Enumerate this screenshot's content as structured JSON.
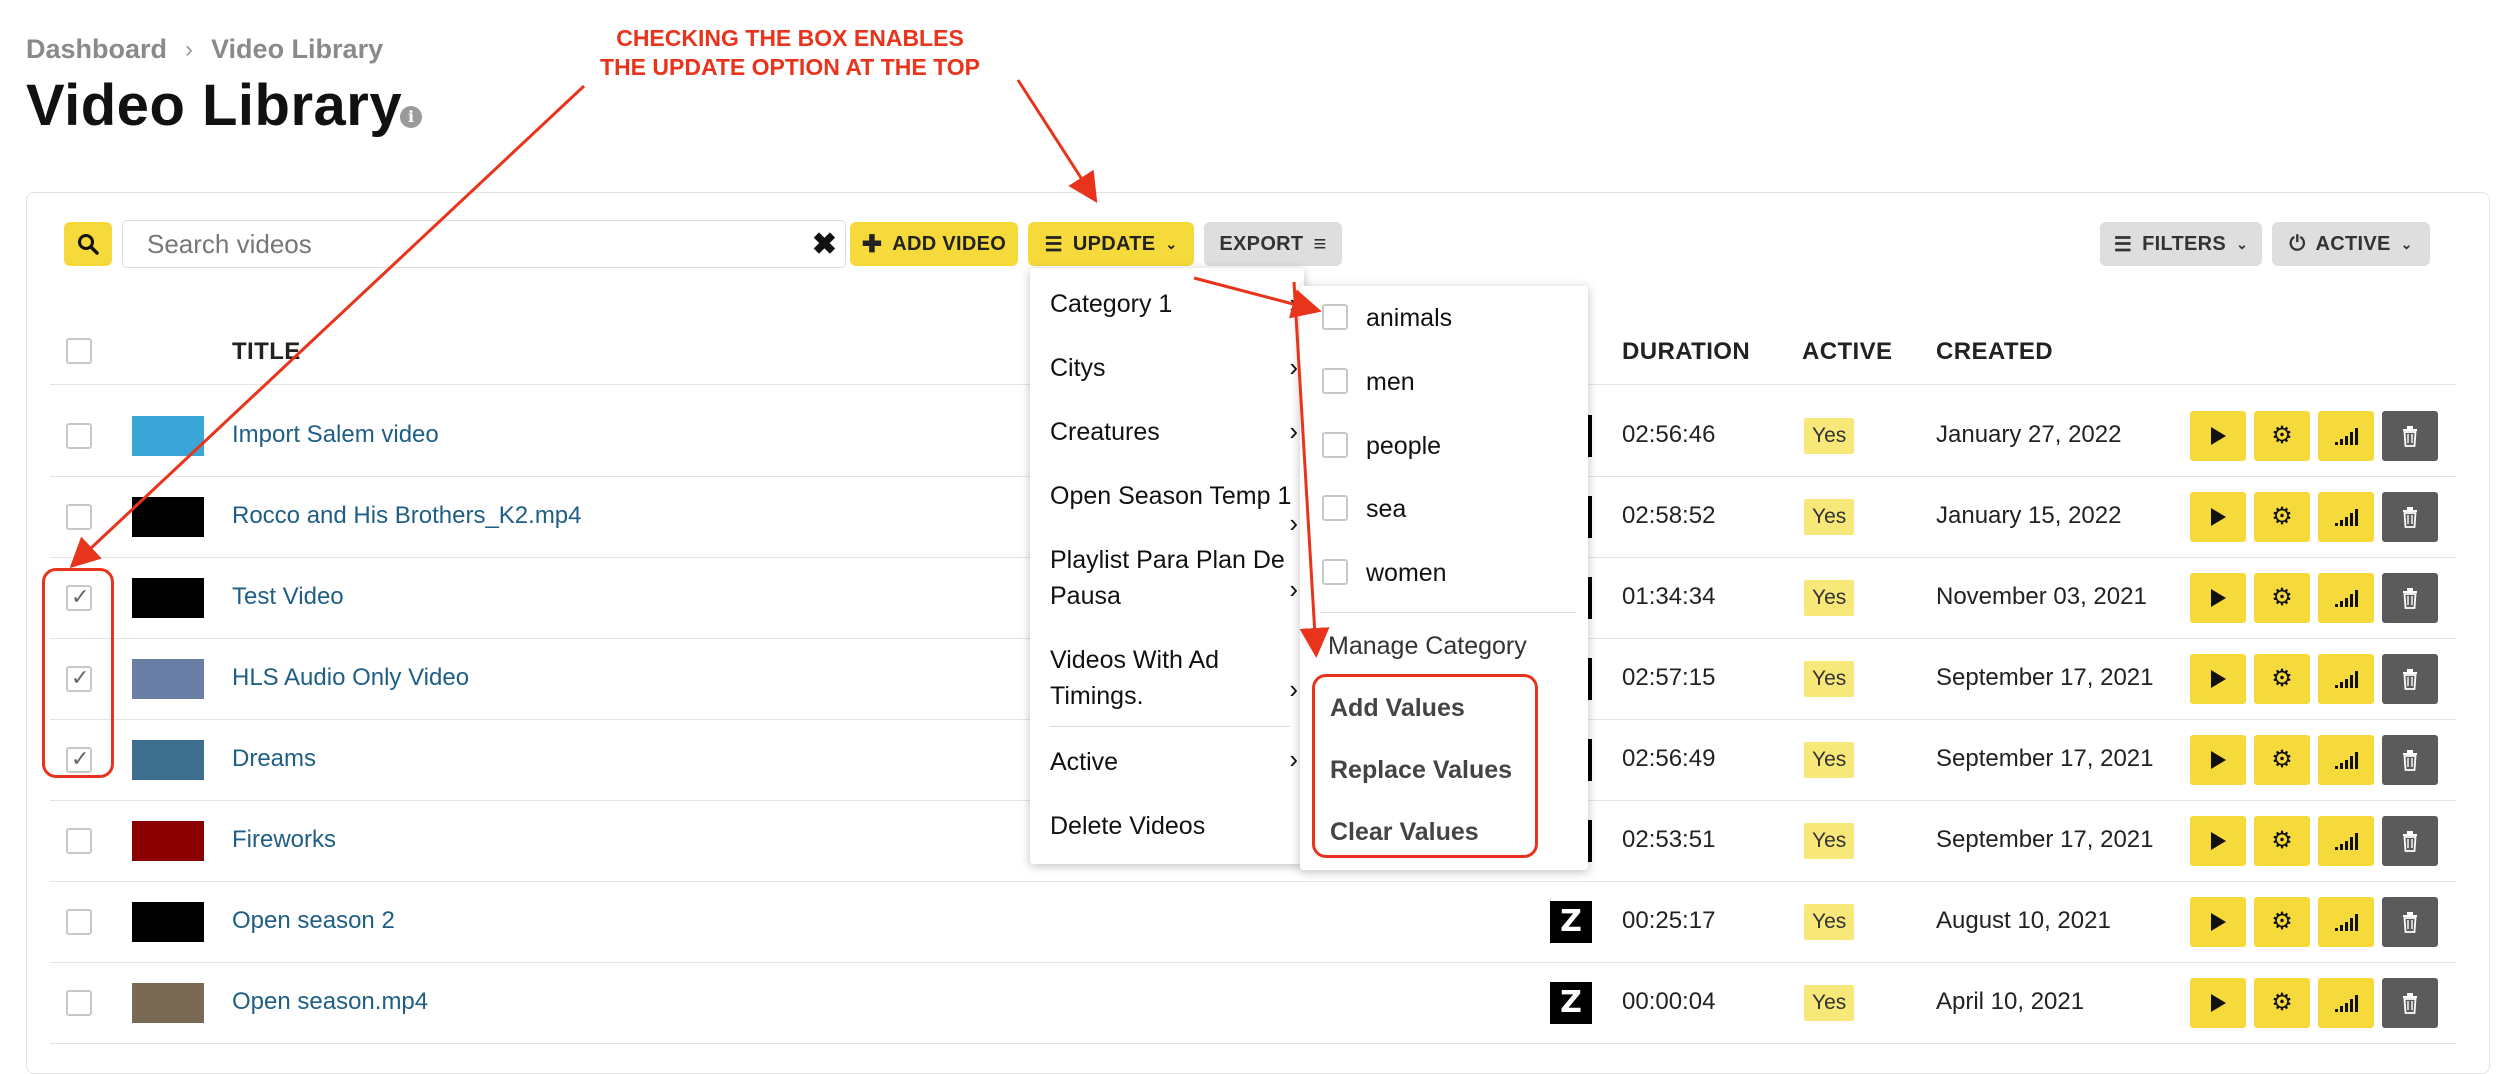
{
  "breadcrumb": {
    "items": [
      "Dashboard",
      "Video Library"
    ],
    "separator": "›"
  },
  "page": {
    "title": "Video Library",
    "info_icon": "i"
  },
  "toolbar": {
    "search_placeholder": "Search videos",
    "add_video_label": "ADD VIDEO",
    "update_label": "UPDATE",
    "export_label": "EXPORT",
    "filters_label": "FILTERS",
    "active_label": "ACTIVE"
  },
  "table": {
    "headers": {
      "title": "TITLE",
      "duration": "DURATION",
      "active": "ACTIVE",
      "created": "CREATED"
    },
    "rows": [
      {
        "title": "Import Salem video",
        "duration": "02:56:46",
        "active": "Yes",
        "created": "January 27, 2022",
        "checked": false
      },
      {
        "title": "Rocco and His Brothers_K2.mp4",
        "duration": "02:58:52",
        "active": "Yes",
        "created": "January 15, 2022",
        "checked": false
      },
      {
        "title": "Test Video",
        "duration": "01:34:34",
        "active": "Yes",
        "created": "November 03, 2021",
        "checked": true
      },
      {
        "title": "HLS Audio Only Video",
        "duration": "02:57:15",
        "active": "Yes",
        "created": "September 17, 2021",
        "checked": true
      },
      {
        "title": "Dreams",
        "duration": "02:56:49",
        "active": "Yes",
        "created": "September 17, 2021",
        "checked": true
      },
      {
        "title": "Fireworks",
        "duration": "02:53:51",
        "active": "Yes",
        "created": "September 17, 2021",
        "checked": false
      },
      {
        "title": "Open season 2",
        "duration": "00:25:17",
        "active": "Yes",
        "created": "August 10, 2021",
        "checked": false
      },
      {
        "title": "Open season.mp4",
        "duration": "00:00:04",
        "active": "Yes",
        "created": "April 10, 2021",
        "checked": false
      }
    ]
  },
  "update_menu": {
    "items": [
      "Category 1",
      "Citys",
      "Creatures",
      "Open Season Temp 1",
      "Playlist Para Plan De Pausa",
      "Videos With Ad Timings.",
      "Active",
      "Delete Videos"
    ]
  },
  "category_submenu": {
    "options": [
      "animals",
      "men",
      "people",
      "sea",
      "women"
    ],
    "manage_label": "Manage Category",
    "actions": [
      "Add Values",
      "Replace Values",
      "Clear Values"
    ]
  },
  "annotation": {
    "line1": "CHECKING THE BOX ENABLES",
    "line2": "THE UPDATE OPTION AT THE TOP"
  },
  "colors": {
    "accent": "#f6d93b",
    "annotation": "#e8341c",
    "link": "#1f5e85",
    "delete": "#5b5b5b"
  }
}
